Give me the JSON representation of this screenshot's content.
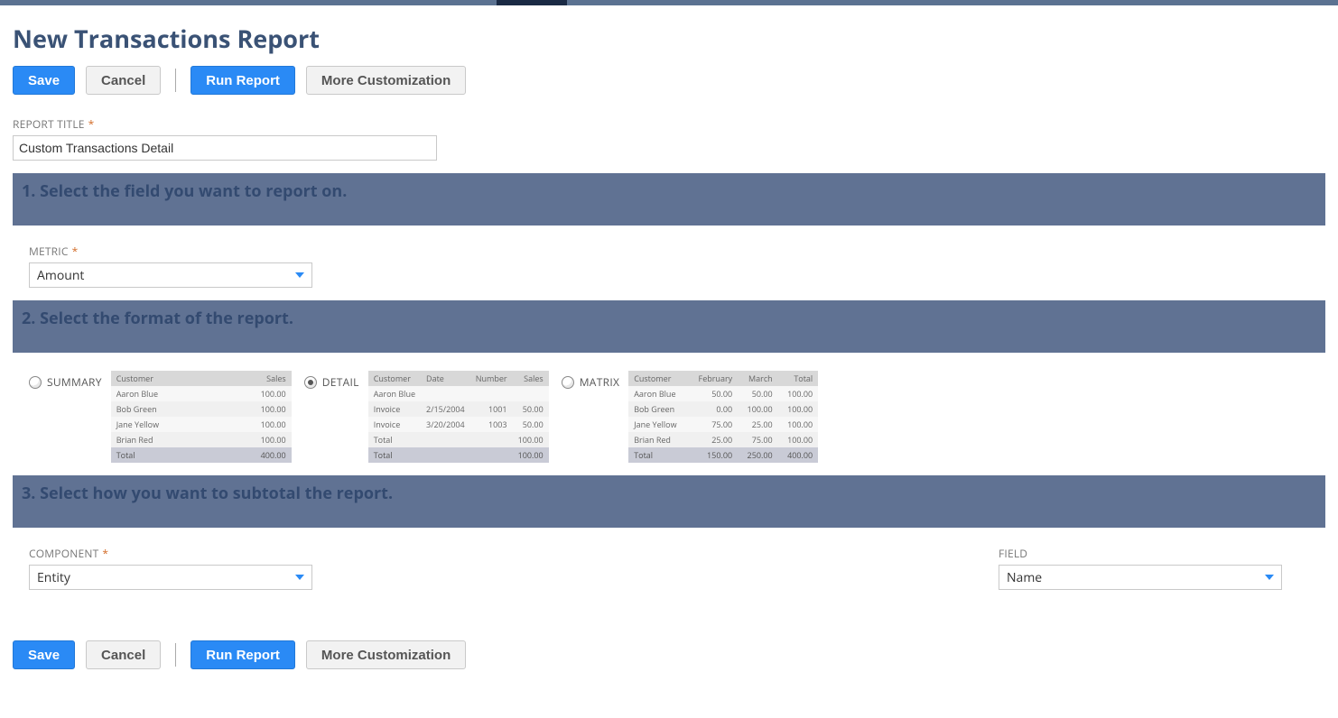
{
  "page_title": "New Transactions Report",
  "buttons": {
    "save": "Save",
    "cancel": "Cancel",
    "run_report": "Run Report",
    "more_customization": "More Customization"
  },
  "report_title": {
    "label": "REPORT TITLE",
    "value": "Custom Transactions Detail"
  },
  "section1": "1. Select the field you want to report on.",
  "metric": {
    "label": "METRIC",
    "value": "Amount"
  },
  "section2": "2. Select the format of the report.",
  "formats": {
    "summary": {
      "label": "SUMMARY",
      "selected": false
    },
    "detail": {
      "label": "DETAIL",
      "selected": true
    },
    "matrix": {
      "label": "MATRIX",
      "selected": false
    }
  },
  "preview_summary": {
    "headers": [
      "Customer",
      "Sales"
    ],
    "rows": [
      [
        "Aaron Blue",
        "100.00"
      ],
      [
        "Bob Green",
        "100.00"
      ],
      [
        "Jane Yellow",
        "100.00"
      ],
      [
        "Brian Red",
        "100.00"
      ]
    ],
    "total": [
      "Total",
      "400.00"
    ]
  },
  "preview_detail": {
    "headers": [
      "Customer",
      "Date",
      "Number",
      "Sales"
    ],
    "rows": [
      [
        "Aaron Blue",
        "",
        "",
        ""
      ],
      [
        "Invoice",
        "2/15/2004",
        "1001",
        "50.00"
      ],
      [
        "Invoice",
        "3/20/2004",
        "1003",
        "50.00"
      ],
      [
        "Total",
        "",
        "",
        "100.00"
      ]
    ],
    "total": [
      "Total",
      "",
      "",
      "100.00"
    ]
  },
  "preview_matrix": {
    "headers": [
      "Customer",
      "February",
      "March",
      "Total"
    ],
    "rows": [
      [
        "Aaron Blue",
        "50.00",
        "50.00",
        "100.00"
      ],
      [
        "Bob Green",
        "0.00",
        "100.00",
        "100.00"
      ],
      [
        "Jane Yellow",
        "75.00",
        "25.00",
        "100.00"
      ],
      [
        "Brian Red",
        "25.00",
        "75.00",
        "100.00"
      ]
    ],
    "total": [
      "Total",
      "150.00",
      "250.00",
      "400.00"
    ]
  },
  "section3": "3. Select how you want to subtotal the report.",
  "component": {
    "label": "COMPONENT",
    "value": "Entity"
  },
  "field": {
    "label": "FIELD",
    "value": "Name"
  }
}
